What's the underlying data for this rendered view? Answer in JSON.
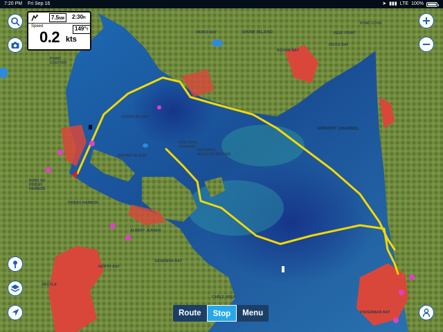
{
  "status_bar": {
    "time": "7:20 PM",
    "date": "Fri Sep 16",
    "network": "LTE",
    "battery": "100%",
    "battery_level": 1.0
  },
  "data_panel": {
    "distance_value": "7.5",
    "distance_unit": "NM",
    "time_value": "2:30",
    "time_unit": "H",
    "speed_label": "Speed",
    "heading_value": "149°",
    "heading_unit": "T",
    "speed_value": "0.2",
    "speed_unit": "kts"
  },
  "controls": {
    "route_label": "Route",
    "stop_label": "Stop",
    "menu_label": "Menu",
    "active": "Stop"
  },
  "map_labels": {
    "shaw_island": "SHAW ISLAND",
    "upright_channel": "UPRIGHT CHANNEL",
    "friday_harbor": "FRIDAY HARBOR",
    "north_bay": "NORTH BAY",
    "argyle": "ARGYLE",
    "cable_area": "CABLE AREA",
    "fisherman_bay": "FISHERMAN BAY",
    "brown_island": "BROWN ISLAND",
    "deadman_bay": "DEADMAN BAY",
    "albert_jensen": "ALBERT JENSEN",
    "san_juan_channel": "SAN JUAN CHANNEL",
    "refuge": "NATIONAL WILDLIFE REFUGE",
    "squaw_bay": "SQUAW BAY",
    "hicks_bay": "HICKS BAY",
    "point_caution": "POINT CAUTION",
    "parks_bay": "PARKS BAY",
    "pond_cove": "POND COVE",
    "reef_point": "REEF POINT",
    "port_of_friday": "PORT OF FRIDAY HARBOR",
    "canoe_island": "CANOE ISLAND"
  },
  "colors": {
    "route": "#f5d800",
    "active_button": "#29a8e8",
    "bottom_bar": "#1c3f66",
    "shallow": "#d9473b",
    "deep": "#1e4e9c",
    "land": "#6f8a3c"
  }
}
